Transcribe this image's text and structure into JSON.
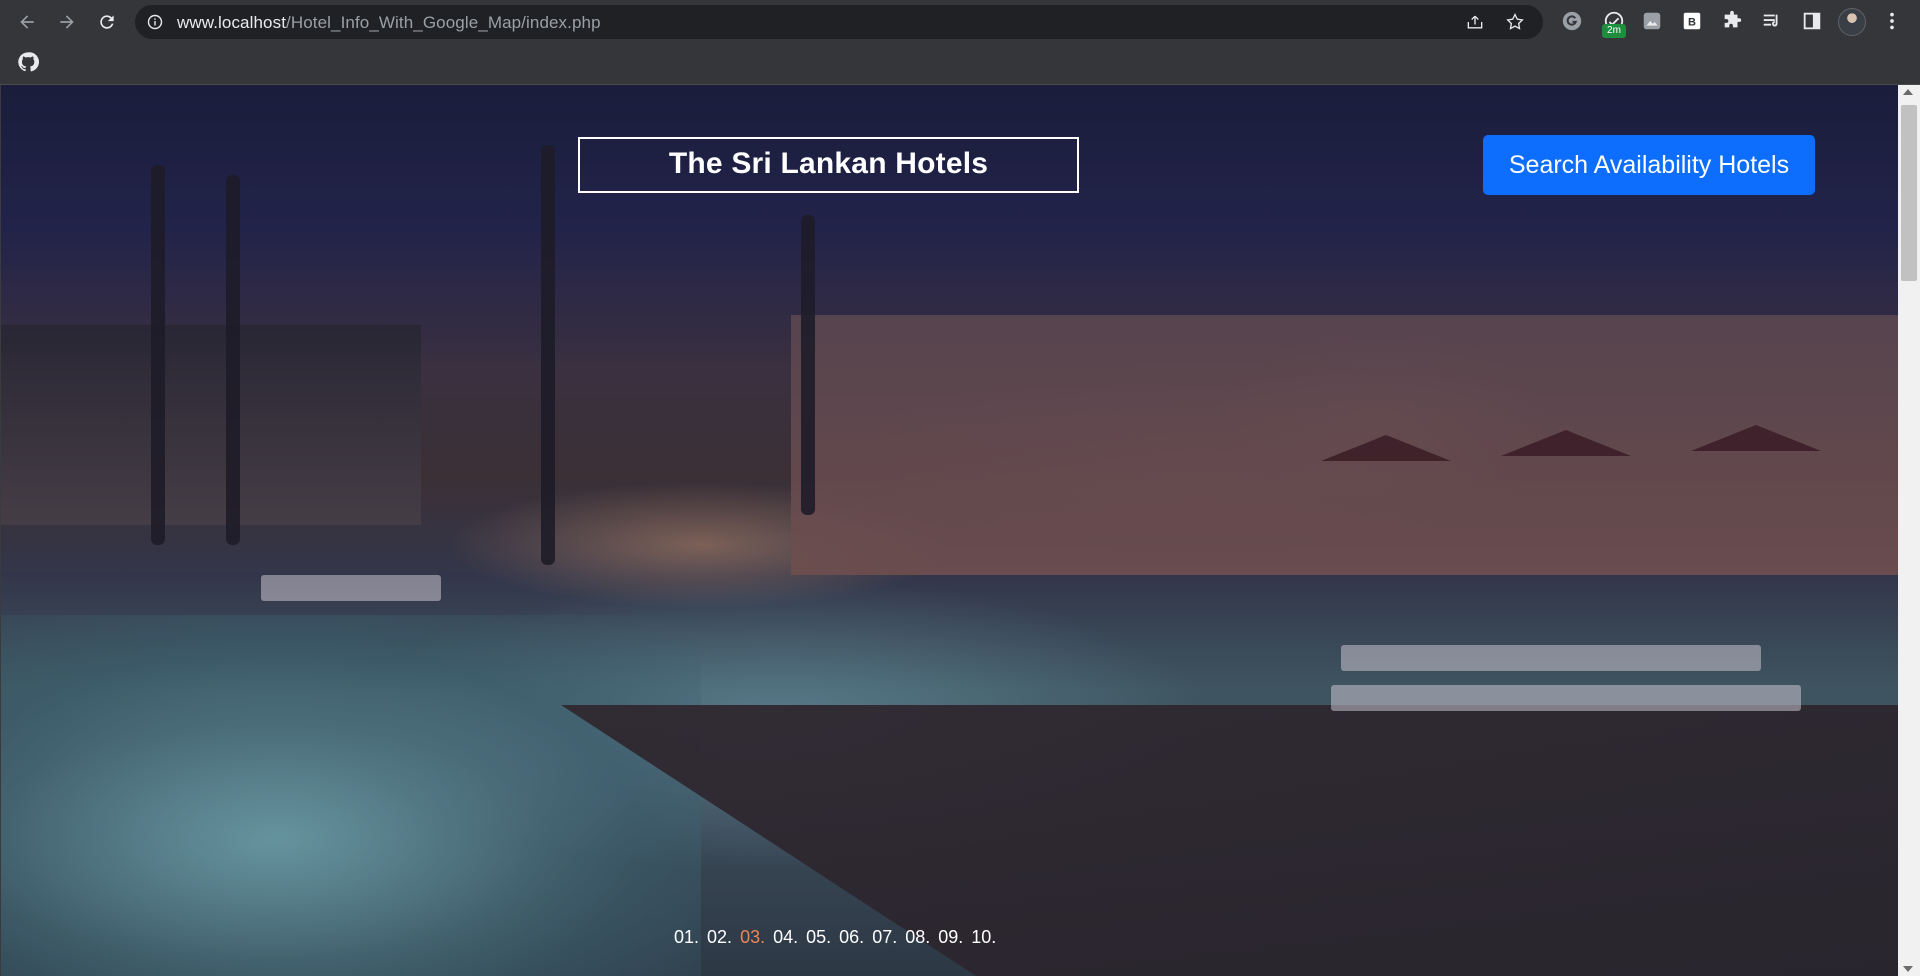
{
  "browser": {
    "url_host": "www.localhost",
    "url_path": "/Hotel_Info_With_Google_Map/index.php",
    "extension_badge": "2m",
    "extension_b_label": "B"
  },
  "page": {
    "title": "The Sri Lankan Hotels",
    "search_button": "Search Availability Hotels",
    "pager": {
      "items": [
        "01.",
        "02.",
        "03.",
        "04.",
        "05.",
        "06.",
        "07.",
        "08.",
        "09.",
        "10."
      ],
      "active_index": 2,
      "active_color": "#e8865a"
    }
  },
  "colors": {
    "accent": "#0d6efd",
    "chrome": "#35363a",
    "omnibox": "#202124"
  }
}
